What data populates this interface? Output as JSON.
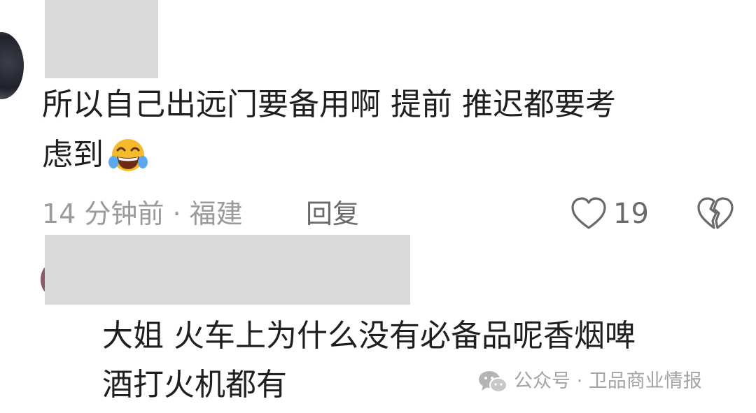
{
  "comment_1": {
    "text_line_1": "所以自己出远门要备用啊  提前 推迟都要考",
    "text_line_2": "虑到",
    "emoji": "tears-of-joy-emoji",
    "meta": "14 分钟前 · 福建",
    "reply_label": "回复",
    "like_count": "19",
    "icons": {
      "like": "heart-outline-icon",
      "dislike": "broken-heart-outline-icon"
    }
  },
  "comment_2": {
    "text_line_1": "大姐 火车上为什么没有必备品呢香烟啤",
    "text_line_2": "酒打火机都有"
  },
  "watermark": {
    "text": "公众号 · 卫品商业情报",
    "icon": "wechat-icon"
  },
  "colors": {
    "text": "#1f1f1f",
    "meta": "#9a9a9a",
    "redaction": "#d9d9d9",
    "emoji_face": "#f5b92b"
  }
}
